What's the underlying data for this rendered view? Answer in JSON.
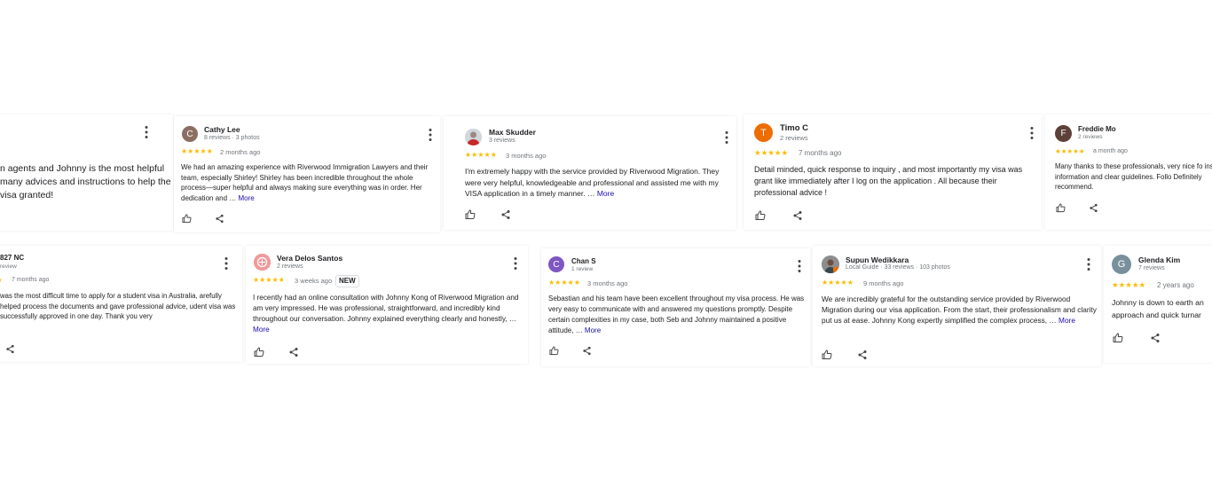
{
  "more_label": "More",
  "new_badge": "NEW",
  "stars": "★★★★★",
  "colors": {
    "star": "#fbbc04",
    "link": "#1a0dab",
    "avatar_cathy": "#8d6e63",
    "avatar_timo": "#ef6c00",
    "avatar_freddie": "#5d4037",
    "avatar_chan": "#7e57c2",
    "avatar_glenda": "#78909c"
  },
  "reviews": [
    {
      "name": "",
      "meta": "",
      "time": "",
      "text": "n agents and Johnny is the most helpful many advices and instructions to help the visa granted!",
      "more": ""
    },
    {
      "name": "Cathy Lee",
      "initial": "C",
      "meta": "8 reviews · 3 photos",
      "time": "2 months ago",
      "text": "We had an amazing experience with Riverwood Immigration Lawyers and their team, especially Shirley! Shirley has been incredible throughout the whole process—super helpful and always making sure everything was in order. Her dedication and … "
    },
    {
      "name": "Max Skudder",
      "meta": "3 reviews",
      "time": "3 months ago",
      "text": "I'm extremely happy with the service provided by Riverwood Migration. They were very helpful, knowledgeable and professional and assisted me with my VISA application in a timely manner. … "
    },
    {
      "name": "Timo C",
      "initial": "T",
      "meta": "2 reviews",
      "time": "7 months ago",
      "text": "Detail minded, quick response to inquiry , and most importantly my visa was grant like immediately after I log on the application . All because their professional advice !"
    },
    {
      "name": "Freddie Mo",
      "initial": "F",
      "meta": "2 reviews",
      "time": "a month ago",
      "text": "Many thanks to these professionals, very nice fo insightful information and clear guidelines. Follo Definitely recommend."
    },
    {
      "name": "827 NC",
      "meta": "review",
      "time": "7 months ago",
      "text": "was the most difficult time to apply for a student visa in Australia, arefully helped process the documents and gave professional advice, udent visa was successfully approved in one day. Thank you very"
    },
    {
      "name": "Vera Delos Santos",
      "meta": "2 reviews",
      "time": "3 weeks ago",
      "text": "I recently had an online consultation with Johnny Kong of Riverwood Migration and am very impressed. He was professional, straightforward, and incredibly kind throughout our conversation. Johnny explained everything clearly and honestly, … "
    },
    {
      "name": "Chan S",
      "initial": "C",
      "meta": "1 review",
      "time": "3 months ago",
      "text": "Sebastian and his team have been excellent throughout my visa process. He was very easy to communicate with and answered my questions promptly. Despite certain complexities in my case, both Seb and Johnny maintained a positive attitude, … "
    },
    {
      "name": "Supun Wedikkara",
      "meta": "Local Guide · 33 reviews · 103 photos",
      "time": "9 months ago",
      "text": "We are incredibly grateful for the outstanding service provided by Riverwood Migration during our visa application. From the start, their professionalism and clarity put us at ease. Johnny Kong expertly simplified the complex process, … "
    },
    {
      "name": "Glenda Kim",
      "initial": "G",
      "meta": "7 reviews",
      "time": "2 years ago",
      "text": "Johnny is down to earth an approach and quick turnar"
    }
  ]
}
